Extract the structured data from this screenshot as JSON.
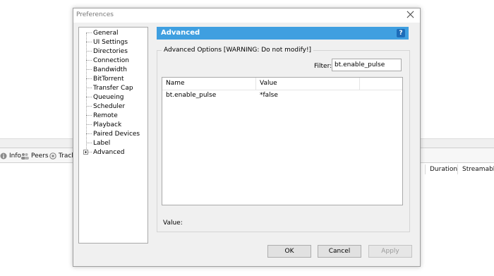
{
  "background": {
    "tabs": [
      {
        "label": "Info",
        "icon": "info-icon"
      },
      {
        "label": "Peers",
        "icon": "peers-icon"
      },
      {
        "label": "Track",
        "icon": "trackers-icon"
      }
    ],
    "columns": [
      "n",
      "Duration",
      "Streamable"
    ]
  },
  "dialog": {
    "title": "Preferences",
    "close_icon": "close-icon",
    "nav": [
      {
        "label": "General"
      },
      {
        "label": "UI Settings"
      },
      {
        "label": "Directories"
      },
      {
        "label": "Connection"
      },
      {
        "label": "Bandwidth"
      },
      {
        "label": "BitTorrent"
      },
      {
        "label": "Transfer Cap"
      },
      {
        "label": "Queueing"
      },
      {
        "label": "Scheduler"
      },
      {
        "label": "Remote"
      },
      {
        "label": "Playback"
      },
      {
        "label": "Paired Devices"
      },
      {
        "label": "Label"
      },
      {
        "label": "Advanced",
        "expandable": true,
        "selected": true
      }
    ],
    "panel": {
      "title": "Advanced",
      "help_label": "?",
      "group_label": "Advanced Options [WARNING: Do not modify!]",
      "filter_label": "Filter:",
      "filter_value": "bt.enable_pulse",
      "columns": [
        "Name",
        "Value"
      ],
      "rows": [
        {
          "name": "bt.enable_pulse",
          "value": "*false"
        }
      ],
      "value_label": "Value:"
    },
    "buttons": {
      "ok": "OK",
      "cancel": "Cancel",
      "apply": "Apply"
    }
  },
  "colors": {
    "accent": "#3f9fe0",
    "dialog_bg": "#f0f0f0"
  }
}
